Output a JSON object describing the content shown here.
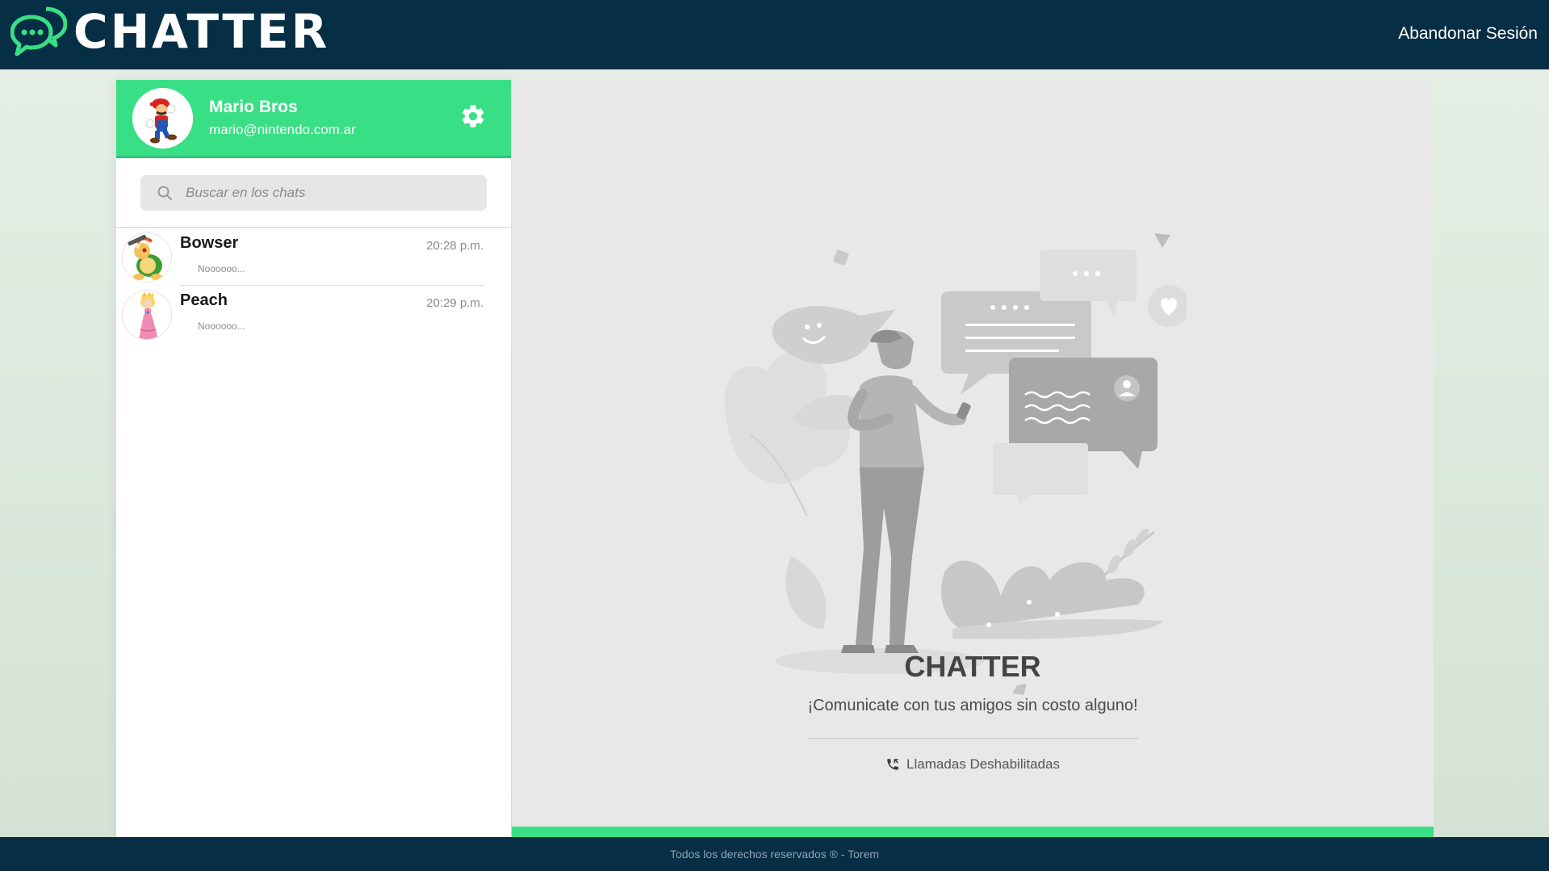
{
  "header": {
    "logo_text": "CHATTER",
    "logout_label": "Abandonar Sesión"
  },
  "profile": {
    "name": "Mario Bros",
    "email": "mario@nintendo.com.ar",
    "avatar": "mario-avatar",
    "settings_icon": "gear-icon"
  },
  "search": {
    "placeholder": "Buscar en los chats",
    "value": ""
  },
  "chats": [
    {
      "name": "Bowser",
      "time": "20:28 p.m.",
      "preview": "Noooooo...",
      "avatar": "bowser-avatar"
    },
    {
      "name": "Peach",
      "time": "20:29 p.m.",
      "preview": "Noooooo...",
      "avatar": "peach-avatar"
    }
  ],
  "welcome": {
    "title": "CHATTER",
    "subtitle": "¡Comunicate con tus amigos sin costo alguno!",
    "calls_label": "Llamadas Deshabilitadas",
    "calls_icon": "phone-icon"
  },
  "footer": {
    "text": "Todos los derechos reservados ® - Torem"
  },
  "colors": {
    "topbar": "#062e45",
    "accent_green": "#39df84",
    "panel_bg": "#e8e8e8",
    "page_bg": "#dde9de"
  }
}
